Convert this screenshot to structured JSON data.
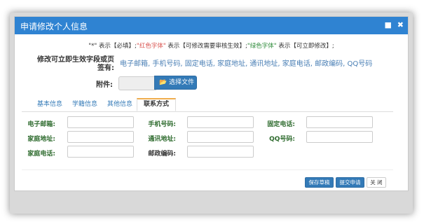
{
  "dialog": {
    "title": "申请修改个人信息",
    "controls": {
      "maximize": "■",
      "close": "✖"
    }
  },
  "legend": {
    "p1": "\"*\" 表示【必填】;",
    "red": "\"红色字体\"",
    "p2": " 表示【可修改需要审核生效】;",
    "green": "\"绿色字体\"",
    "p3": " 表示【可立即修改】;"
  },
  "editable": {
    "label": "修改可立即生效字段或页签有:",
    "fields": "电子邮箱, 手机号码, 固定电话, 家庭地址, 通讯地址, 家庭电话, 邮政编码, QQ号码"
  },
  "attachment": {
    "label": "附件:",
    "button": "选择文件"
  },
  "tabs": [
    "基本信息",
    "学籍信息",
    "其他信息",
    "联系方式"
  ],
  "active_tab": "联系方式",
  "contact_form": {
    "email": "电子邮箱:",
    "mobile": "手机号码:",
    "landline": "固定电话:",
    "home_address": "家庭地址:",
    "mail_address": "通讯地址:",
    "qq": "QQ号码:",
    "home_phone": "家庭电话:",
    "postcode": "邮政编码:"
  },
  "footer": {
    "save_draft": "保存草稿",
    "submit": "提交申请",
    "close": "关 闭"
  }
}
